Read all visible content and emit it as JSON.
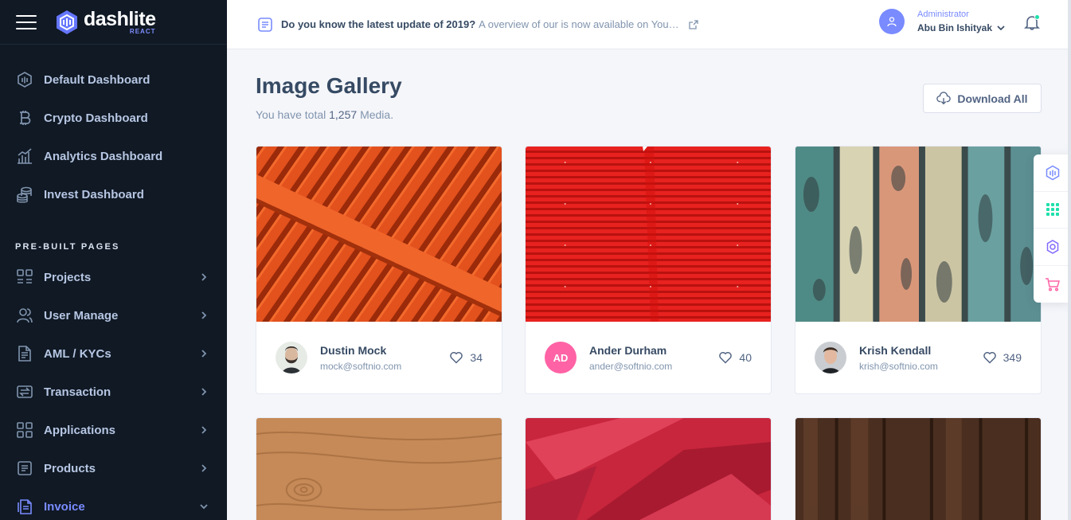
{
  "brand": {
    "name": "dashlite",
    "sub": "REACT"
  },
  "sidebar": {
    "items": [
      {
        "label": "Default Dashboard",
        "icon": "dashlite-icon"
      },
      {
        "label": "Crypto Dashboard",
        "icon": "bitcoin-icon"
      },
      {
        "label": "Analytics Dashboard",
        "icon": "bar-chart-icon"
      },
      {
        "label": "Invest Dashboard",
        "icon": "coins-icon"
      }
    ],
    "section_heading": "PRE-BUILT PAGES",
    "pages": [
      {
        "label": "Projects",
        "icon": "grid-list-icon"
      },
      {
        "label": "User Manage",
        "icon": "users-icon"
      },
      {
        "label": "AML / KYCs",
        "icon": "file-doc-icon"
      },
      {
        "label": "Transaction",
        "icon": "exchange-icon"
      },
      {
        "label": "Applications",
        "icon": "apps-icon"
      },
      {
        "label": "Products",
        "icon": "list-box-icon"
      },
      {
        "label": "Invoice",
        "icon": "invoice-icon"
      }
    ]
  },
  "header": {
    "news_title": "Do you know the latest update of 2019?",
    "news_text": "A overview of our is now available on You…",
    "user_role": "Administrator",
    "user_name": "Abu Bin Ishityak"
  },
  "main": {
    "title": "Image Gallery",
    "subtitle_pre": "You have total",
    "subtitle_count": "1,257",
    "subtitle_post": "Media.",
    "download_label": "Download All"
  },
  "gallery": [
    {
      "name": "Dustin Mock",
      "email": "mock@softnio.com",
      "likes": "34"
    },
    {
      "name": "Ander Durham",
      "email": "ander@softnio.com",
      "likes": "40",
      "initials": "AD"
    },
    {
      "name": "Krish Kendall",
      "email": "krish@softnio.com",
      "likes": "349"
    }
  ],
  "colors": {
    "sidebar_bg": "#101924",
    "accent": "#798bff",
    "active_badge": "#ff63a5",
    "online_dot": "#1ee0ac"
  }
}
